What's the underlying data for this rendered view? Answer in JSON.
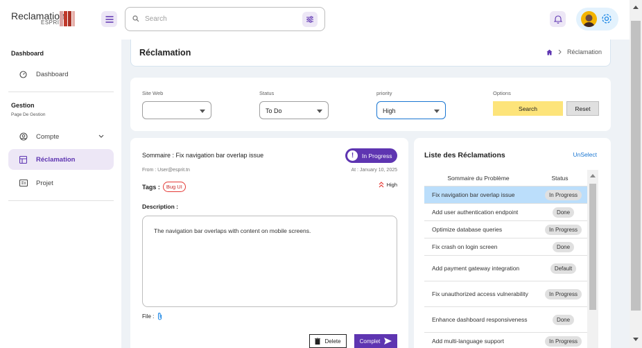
{
  "app": {
    "logo_text": "Reclamation",
    "logo_sub": "ESPRIT"
  },
  "search": {
    "placeholder": "Search"
  },
  "sidebar": {
    "section1": "Dashboard",
    "dashboard_label": "Dashboard",
    "section2": "Gestion",
    "section2_sub": "Page De Gestion",
    "items": [
      {
        "label": "Compte"
      },
      {
        "label": "Réclamation"
      },
      {
        "label": "Projet"
      }
    ]
  },
  "breadcrumb": {
    "title": "Réclamation",
    "current": "Réclamation"
  },
  "filters": {
    "site_label": "Site Web",
    "site_value": "",
    "status_label": "Status",
    "status_value": "To Do",
    "priority_label": "priority",
    "priority_value": "High",
    "options_label": "Options",
    "search_btn": "Search",
    "reset_btn": "Reset"
  },
  "detail": {
    "title": "Sommaire : Fix navigation bar overlap issue",
    "status": "In Progress",
    "from": "From : User@esprit.tn",
    "at": "At : January 10, 2025",
    "tags_label": "Tags :",
    "tag": "Bug UI",
    "priority": "High",
    "description_label": "Description :",
    "description": "The navigation bar overlaps with content on mobile screens.",
    "file_label": "File :",
    "delete_btn": "Delete",
    "complete_btn": "Complet"
  },
  "list": {
    "title": "Liste des Réclamations",
    "unselect": "UnSelect",
    "col1": "Sommaire du Problème",
    "col2": "Status",
    "rows": [
      {
        "summary": "Fix navigation bar overlap issue",
        "status": "In Progress"
      },
      {
        "summary": "Add user authentication endpoint",
        "status": "Done"
      },
      {
        "summary": "Optimize database queries",
        "status": "In Progress"
      },
      {
        "summary": "Fix crash on login screen",
        "status": "Done"
      },
      {
        "summary": "Add payment gateway integration",
        "status": "Default"
      },
      {
        "summary": "Fix unauthorized access vulnerability",
        "status": "In Progress"
      },
      {
        "summary": "Enhance dashboard responsiveness",
        "status": "Done"
      },
      {
        "summary": "Add multi-language support",
        "status": "In Progress"
      }
    ]
  },
  "colors": {
    "primary": "#5e35b1",
    "accent_light": "#ede7f6",
    "search_btn": "#fde47a",
    "selected_row": "#bbdefb"
  }
}
